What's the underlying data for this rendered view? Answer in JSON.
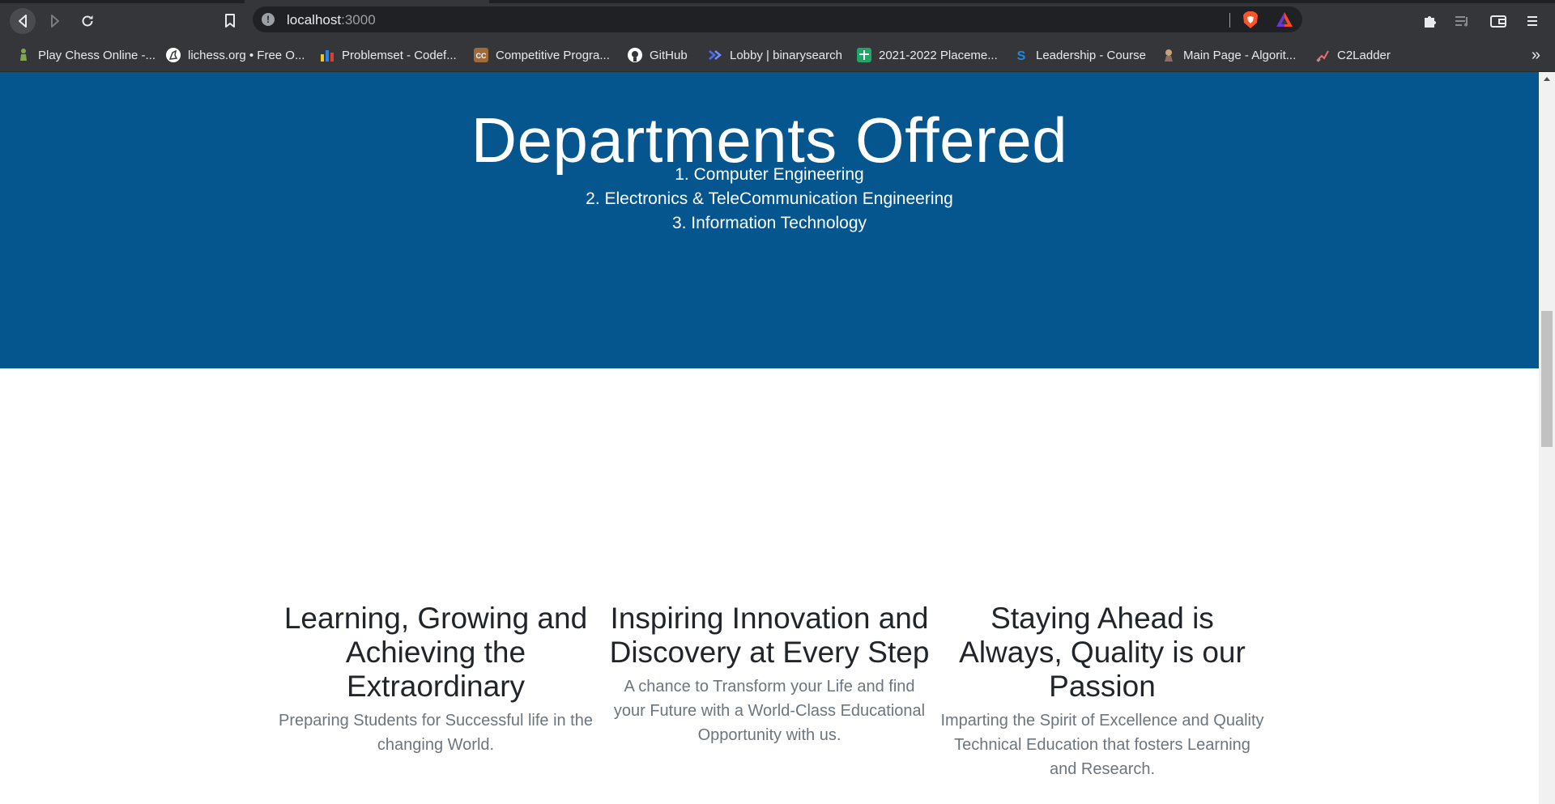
{
  "browser": {
    "address": {
      "host": "localhost",
      "port": ":3000"
    },
    "bookmarks": [
      {
        "label": "Play Chess Online -...",
        "icon": "chess-pawn-icon",
        "color": "#6b9a3d"
      },
      {
        "label": "lichess.org • Free O...",
        "icon": "lichess-icon",
        "color": "#ffffff"
      },
      {
        "label": "Problemset - Codef...",
        "icon": "codeforces-icon",
        "color": "#f5c518"
      },
      {
        "label": "Competitive Progra...",
        "icon": "cc-icon",
        "color": "#a06a3a"
      },
      {
        "label": "GitHub",
        "icon": "github-icon",
        "color": "#ffffff"
      },
      {
        "label": "Lobby | binarysearch",
        "icon": "binarysearch-icon",
        "color": "#4a6cf7"
      },
      {
        "label": "2021-2022 Placeme...",
        "icon": "sheets-icon",
        "color": "#23a566"
      },
      {
        "label": "Leadership - Course",
        "icon": "s-logo-icon",
        "color": "#1e88e5"
      },
      {
        "label": "Main Page - Algorit...",
        "icon": "algorithmica-icon",
        "color": "#c8a27a"
      },
      {
        "label": "C2Ladder",
        "icon": "c2ladder-icon",
        "color": "#e57373"
      }
    ],
    "more_bookmarks": "»"
  },
  "departments": {
    "title": "Departments Offered",
    "items": [
      "1. Computer Engineering",
      "2. Electronics & TeleCommunication Engineering",
      "3. Information Technology"
    ],
    "background": "#05558f"
  },
  "features": [
    {
      "title": "Learning, Growing and Achieving the Extraordinary",
      "text": "Preparing Students for Successful life in the changing World."
    },
    {
      "title": "Inspiring Innovation and Discovery at Every Step",
      "text": "A chance to Transform your Life and find your Future with a World-Class Educational Opportunity with us."
    },
    {
      "title": "Staying Ahead is Always, Quality is our Passion",
      "text": "Imparting the Spirit of Excellence and Quality Technical Education that fosters Learning and Research."
    }
  ]
}
